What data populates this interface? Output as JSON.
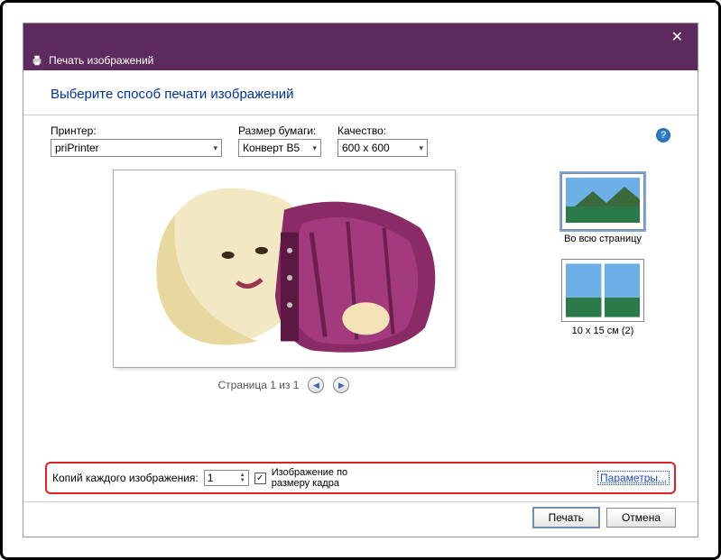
{
  "titlebar": {
    "close": "✕"
  },
  "header": {
    "title": "Печать изображений"
  },
  "subtitle": "Выберите способ печати изображений",
  "controls": {
    "printer": {
      "label": "Принтер:",
      "value": "priPrinter"
    },
    "paper": {
      "label": "Размер бумаги:",
      "value": "Конверт B5"
    },
    "quality": {
      "label": "Качество:",
      "value": "600 x 600"
    }
  },
  "help": "?",
  "pager": {
    "text": "Страница 1 из 1",
    "prev": "◀",
    "next": "▶"
  },
  "layouts": {
    "full": "Во всю страницу",
    "half": "10 x 15 см (2)"
  },
  "bottom": {
    "copies_label": "Копий каждого изображения:",
    "copies_value": "1",
    "fit_check": "✓",
    "fit_label_l1": "Изображение по",
    "fit_label_l2": "размеру кадра",
    "params": "Параметры..."
  },
  "footer": {
    "print": "Печать",
    "cancel": "Отмена"
  }
}
